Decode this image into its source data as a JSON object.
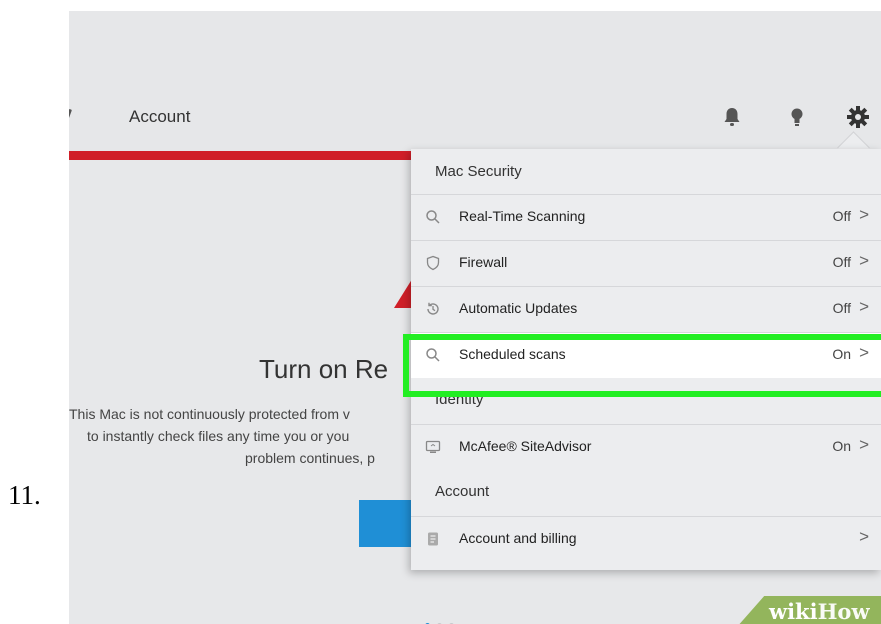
{
  "step_number": "11.",
  "nav": {
    "account_label": "Account",
    "icons": [
      "bell-icon",
      "bulb-icon",
      "gear-icon"
    ]
  },
  "background": {
    "headline": "Turn on Re",
    "body_line1": "This Mac is not continuously protected from v",
    "body_line2": "to instantly check files any time you or you",
    "body_line3": "problem continues, p"
  },
  "dropdown": {
    "section_mac_security": "Mac Security",
    "section_identity": "Identity",
    "section_account": "Account",
    "items": [
      {
        "label": "Real-Time Scanning",
        "value": "Off",
        "icon": "search-icon"
      },
      {
        "label": "Firewall",
        "value": "Off",
        "icon": "shield-icon"
      },
      {
        "label": "Automatic Updates",
        "value": "Off",
        "icon": "clock-refresh-icon"
      },
      {
        "label": "Scheduled scans",
        "value": "On",
        "icon": "search-icon"
      },
      {
        "label": "McAfee® SiteAdvisor",
        "value": "On",
        "icon": "monitor-icon"
      },
      {
        "label": "Account and billing",
        "value": "",
        "icon": "document-icon"
      }
    ],
    "chevron": ">"
  },
  "watermark": {
    "wiki": "wiki",
    "how": "How"
  },
  "colors": {
    "accent_red": "#d01f28",
    "accent_blue": "#1f8fd6",
    "highlight_green": "#22ee22",
    "watermark_green": "#93b55c"
  }
}
